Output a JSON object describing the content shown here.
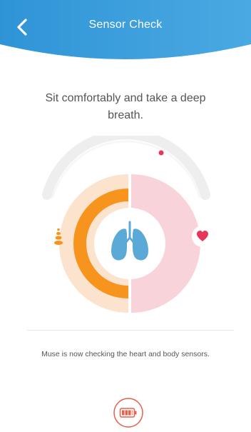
{
  "header": {
    "title": "Sensor Check",
    "back_icon": "chevron-left-icon",
    "background_color": "#3a9edb"
  },
  "instruction": "Sit comfortably and take a deep breath.",
  "gauge": {
    "left_icon": "meditation-stones-icon",
    "right_icon": "heart-icon",
    "center_icon": "lungs-icon",
    "left_color": "#f7941d",
    "right_color": "#e8365a",
    "lungs_color": "#5ba9d6"
  },
  "status": "Muse is now checking the heart and body sensors.",
  "footer": {
    "battery_icon": "battery-icon",
    "battery_color": "#e8604a"
  }
}
